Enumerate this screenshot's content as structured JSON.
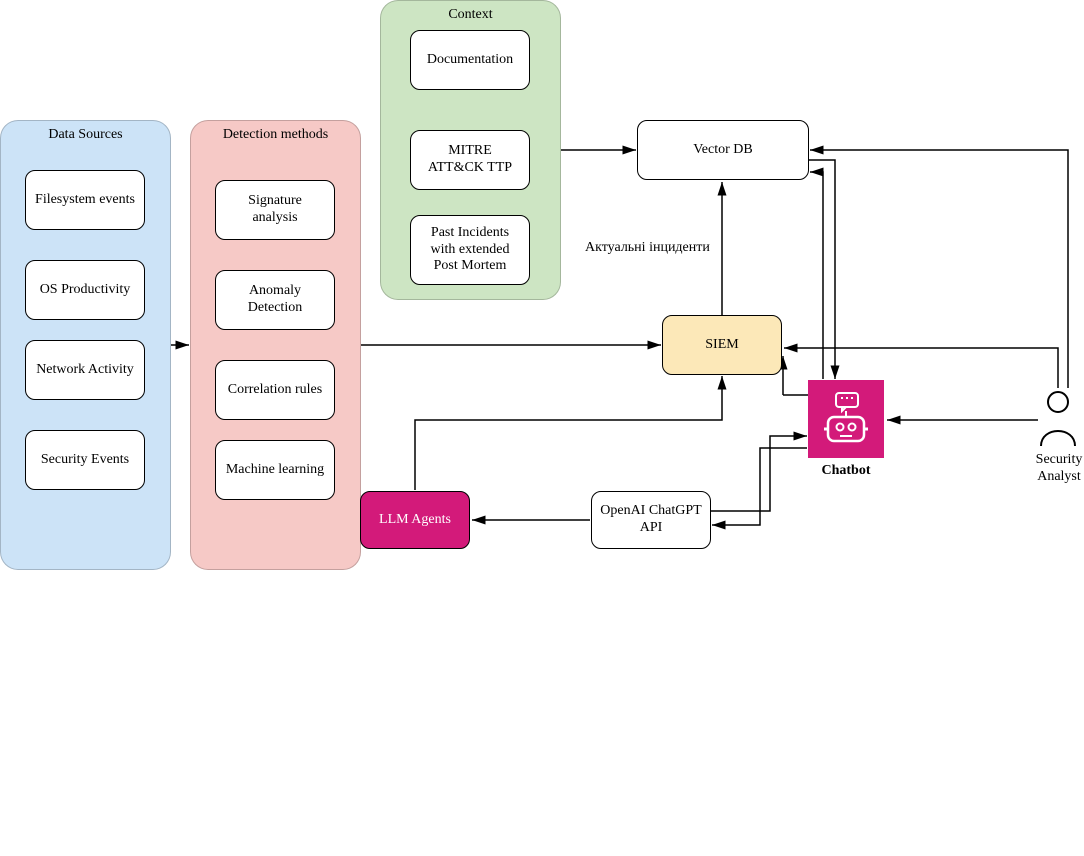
{
  "groups": {
    "data_sources": {
      "title": "Data Sources"
    },
    "detection_methods": {
      "title": "Detection methods"
    },
    "context": {
      "title": "Context"
    }
  },
  "blocks": {
    "filesystem_events": "Filesystem events",
    "os_productivity": "OS Productivity",
    "network_activity": "Network Activity",
    "security_events": "Security Events",
    "signature_analysis": "Signature analysis",
    "anomaly_detection": "Anomaly Detection",
    "correlation_rules": "Correlation rules",
    "machine_learning": "Machine learning",
    "documentation": "Documentation",
    "mitre": "MITRE ATT&CK TTP",
    "past_incidents": "Past Incidents with extended Post Mortem",
    "vector_db": "Vector DB",
    "siem": "SIEM",
    "openai_api": "OpenAI ChatGPT API",
    "llm_agents": "LLM Agents",
    "chatbot": "Chatbot",
    "security_analyst": "Security Analyst"
  },
  "labels": {
    "current_incidents": "Актуальні інциденти"
  },
  "colors": {
    "data_sources_bg": "#cce3f7",
    "detection_bg": "#f6c9c6",
    "context_bg": "#cde5c3",
    "siem_bg": "#fce8b8",
    "accent": "#d31a7a"
  }
}
